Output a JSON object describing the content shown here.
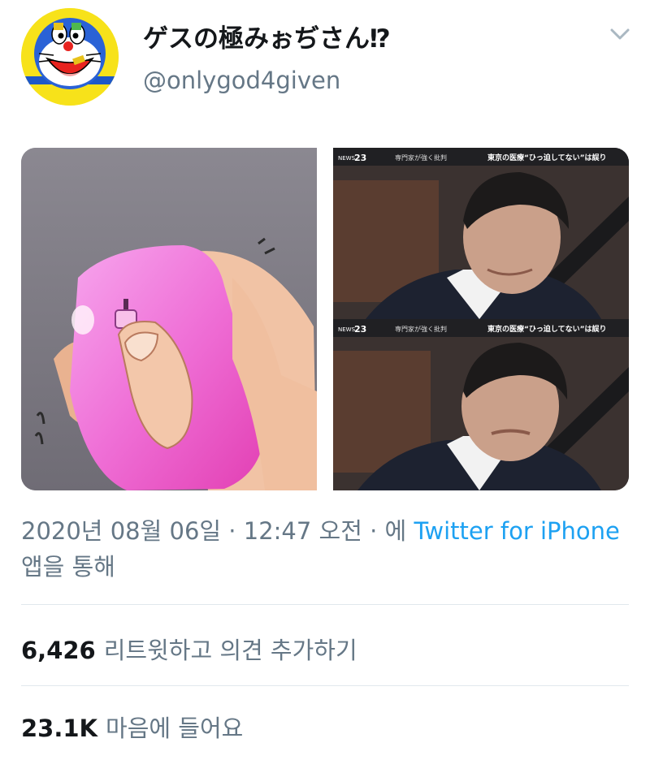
{
  "user": {
    "display_name": "ゲスの極みぉぢさん",
    "display_name_suffix": "⁉",
    "handle": "@onlygod4given"
  },
  "media": {
    "news_overlay": {
      "logo_small": "NEWS",
      "logo_number": "23",
      "subtitle": "専門家が強く批判",
      "headline": "東京の医療“ひっ迫してない”は誤り"
    }
  },
  "timestamp": {
    "date_time": "2020년 08월 06일 · 12:47 오전 · 에 ",
    "app_name": "Twitter for iPhone",
    "suffix": " 앱을 통해"
  },
  "stats": {
    "retweets_count": "6,426",
    "retweets_label": "리트윗하고 의견 추가하기",
    "likes_count": "23.1K",
    "likes_label": "마음에 들어요"
  },
  "colors": {
    "link": "#1da1f2",
    "secondary_text": "#657786",
    "avatar_yellow": "#f7e21a"
  }
}
